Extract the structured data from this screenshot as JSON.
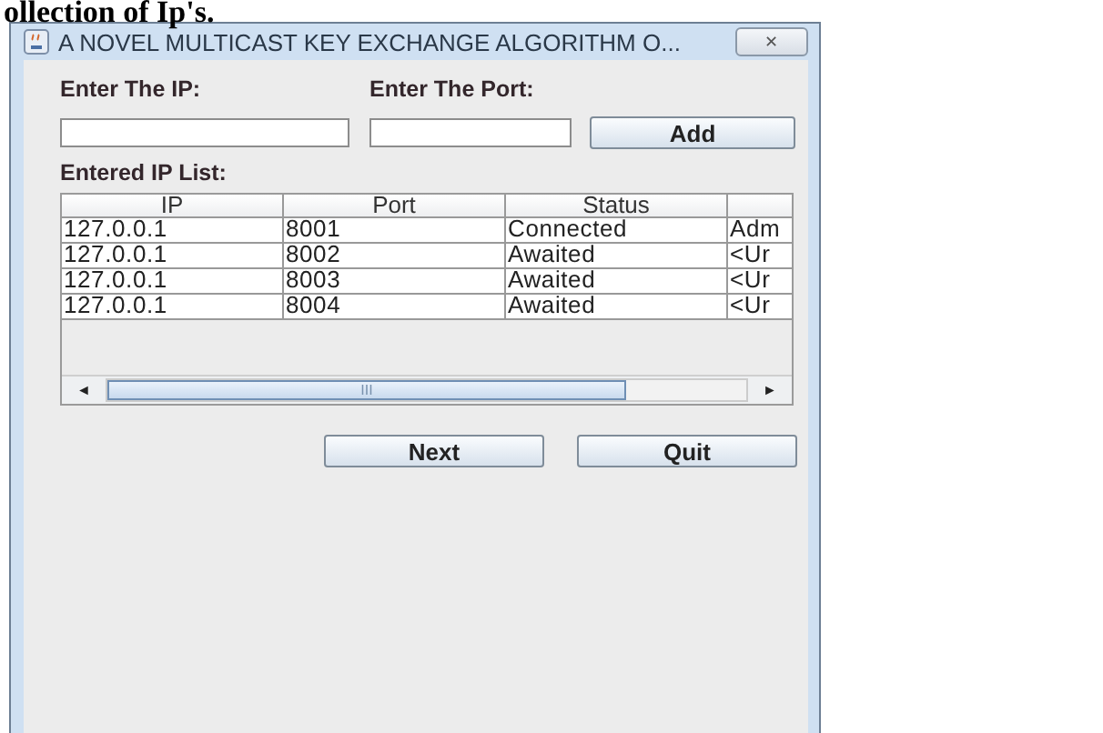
{
  "caption": "ollection of Ip's.",
  "window": {
    "title": "A NOVEL MULTICAST KEY EXCHANGE ALGORITHM O...",
    "close": "✕"
  },
  "form": {
    "ip_label": "Enter The IP:",
    "port_label": "Enter The Port:",
    "add_button": "Add"
  },
  "list_label": "Entered IP List:",
  "table": {
    "columns": [
      "IP",
      "Port",
      "Status"
    ],
    "rows": [
      [
        "127.0.0.1",
        "8001",
        "Connected",
        "Adm"
      ],
      [
        "127.0.0.1",
        "8002",
        "Awaited",
        "<Ur"
      ],
      [
        "127.0.0.1",
        "8003",
        "Awaited",
        "<Ur"
      ],
      [
        "127.0.0.1",
        "8004",
        "Awaited",
        "<Ur"
      ]
    ],
    "scroll_grip": "III",
    "scroll_left": "◄",
    "scroll_right": "►"
  },
  "buttons": [
    "Next",
    "Quit"
  ]
}
